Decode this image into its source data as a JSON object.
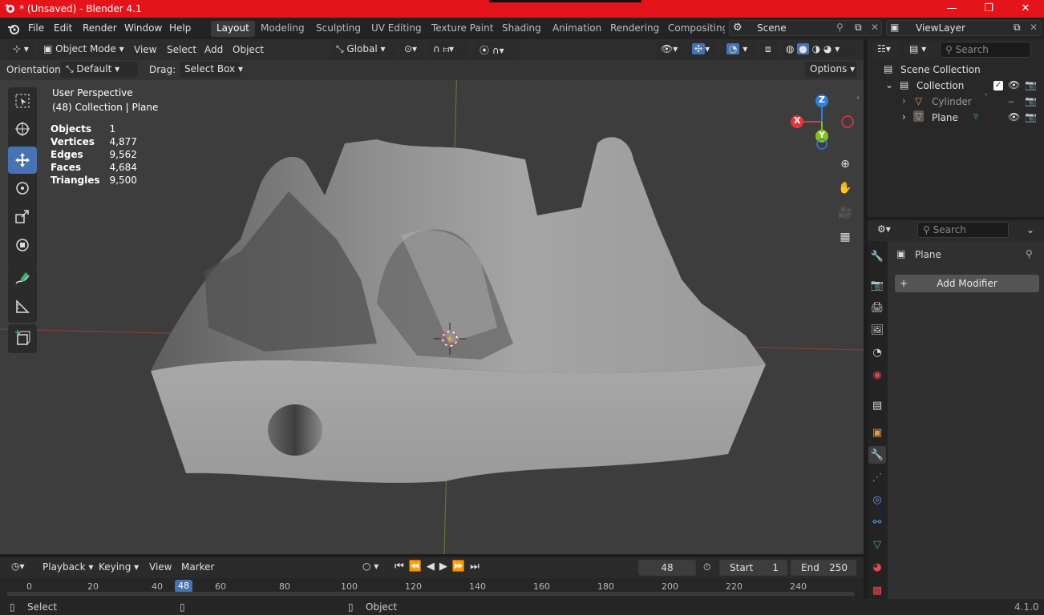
{
  "window": {
    "title": "* (Unsaved) - Blender 4.1",
    "controls": {
      "minimize": "—",
      "maximize": "❐",
      "close": "✕"
    }
  },
  "menu": {
    "items": [
      "File",
      "Edit",
      "Render",
      "Window",
      "Help"
    ]
  },
  "workspaces": [
    "Layout",
    "Modeling",
    "Sculpting",
    "UV Editing",
    "Texture Paint",
    "Shading",
    "Animation",
    "Rendering",
    "Compositing"
  ],
  "active_workspace": "Layout",
  "scene_field": "Scene",
  "viewlayer_field": "ViewLayer",
  "viewport": {
    "mode": "Object Mode",
    "menus": [
      "View",
      "Select",
      "Add",
      "Object"
    ],
    "transform_orientation": "Global",
    "orientation_label": "Orientation:",
    "orientation_value": "Default",
    "drag_label": "Drag:",
    "drag_value": "Select Box",
    "options_label": "Options",
    "overlay_title": "User Perspective",
    "overlay_subtitle": "(48) Collection | Plane",
    "stats": [
      {
        "label": "Objects",
        "value": "1"
      },
      {
        "label": "Vertices",
        "value": "4,877"
      },
      {
        "label": "Edges",
        "value": "9,562"
      },
      {
        "label": "Faces",
        "value": "4,684"
      },
      {
        "label": "Triangles",
        "value": "9,500"
      }
    ],
    "gizmo_axes": {
      "z": "Z",
      "x": "X",
      "y": "Y"
    }
  },
  "outliner": {
    "search_placeholder": "Search",
    "root": "Scene Collection",
    "collection": "Collection",
    "objects": [
      "Cylinder",
      "Plane"
    ]
  },
  "properties": {
    "search_placeholder": "Search",
    "object_name": "Plane",
    "add_modifier_label": "Add Modifier"
  },
  "timeline": {
    "menus": [
      "Playback",
      "Keying",
      "View",
      "Marker"
    ],
    "current_frame": "48",
    "start_label": "Start",
    "start_value": "1",
    "end_label": "End",
    "end_value": "250",
    "ticks": [
      "0",
      "20",
      "40",
      "60",
      "80",
      "100",
      "120",
      "140",
      "160",
      "180",
      "200",
      "220",
      "240"
    ],
    "playhead": "48"
  },
  "status": {
    "left": "Select",
    "middle": "Object",
    "version": "4.1.0"
  },
  "colors": {
    "title_bar": "#e5141b",
    "accent": "#4772b3",
    "viewport_bg": "#3d3d3d",
    "axis_x": "#e4363d",
    "axis_y": "#84c21b",
    "axis_z": "#2d7fe2"
  }
}
